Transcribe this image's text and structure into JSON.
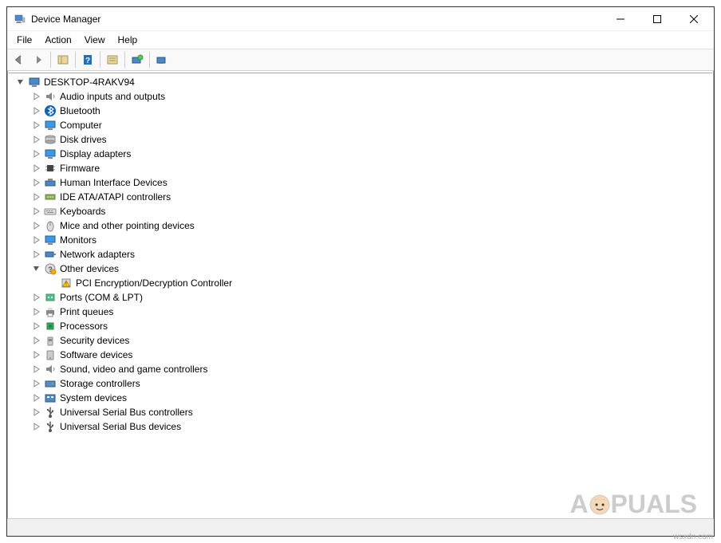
{
  "window": {
    "title": "Device Manager"
  },
  "menu": {
    "file": "File",
    "action": "Action",
    "view": "View",
    "help": "Help"
  },
  "tree": {
    "root": {
      "label": "DESKTOP-4RAKV94",
      "icon": "computer"
    },
    "categories": [
      {
        "label": "Audio inputs and outputs",
        "icon": "speaker",
        "expanded": false
      },
      {
        "label": "Bluetooth",
        "icon": "bluetooth",
        "expanded": false
      },
      {
        "label": "Computer",
        "icon": "monitor-blue",
        "expanded": false
      },
      {
        "label": "Disk drives",
        "icon": "disk",
        "expanded": false
      },
      {
        "label": "Display adapters",
        "icon": "monitor-blue",
        "expanded": false
      },
      {
        "label": "Firmware",
        "icon": "chip",
        "expanded": false
      },
      {
        "label": "Human Interface Devices",
        "icon": "hid",
        "expanded": false
      },
      {
        "label": "IDE ATA/ATAPI controllers",
        "icon": "ide",
        "expanded": false
      },
      {
        "label": "Keyboards",
        "icon": "keyboard",
        "expanded": false
      },
      {
        "label": "Mice and other pointing devices",
        "icon": "mouse",
        "expanded": false
      },
      {
        "label": "Monitors",
        "icon": "monitor-blue",
        "expanded": false
      },
      {
        "label": "Network adapters",
        "icon": "network",
        "expanded": false
      },
      {
        "label": "Other devices",
        "icon": "unknown",
        "expanded": true,
        "children": [
          {
            "label": "PCI Encryption/Decryption Controller",
            "icon": "warning"
          }
        ]
      },
      {
        "label": "Ports (COM & LPT)",
        "icon": "port",
        "expanded": false
      },
      {
        "label": "Print queues",
        "icon": "printer",
        "expanded": false
      },
      {
        "label": "Processors",
        "icon": "cpu",
        "expanded": false
      },
      {
        "label": "Security devices",
        "icon": "security",
        "expanded": false
      },
      {
        "label": "Software devices",
        "icon": "software",
        "expanded": false
      },
      {
        "label": "Sound, video and game controllers",
        "icon": "speaker",
        "expanded": false
      },
      {
        "label": "Storage controllers",
        "icon": "storage",
        "expanded": false
      },
      {
        "label": "System devices",
        "icon": "system",
        "expanded": false
      },
      {
        "label": "Universal Serial Bus controllers",
        "icon": "usb",
        "expanded": false
      },
      {
        "label": "Universal Serial Bus devices",
        "icon": "usb",
        "expanded": false
      }
    ]
  },
  "watermark": {
    "text": "APPUALS"
  },
  "credit": "wsxdn.com"
}
